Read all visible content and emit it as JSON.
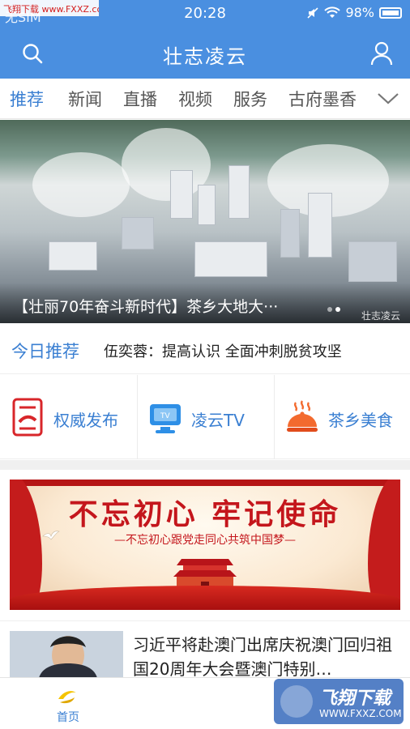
{
  "watermark_top": "飞翔下载 www.FXXZ.com",
  "status_bar": {
    "carrier": "无SIM",
    "time": "20:28",
    "battery": "98%"
  },
  "navbar": {
    "title": "壮志凌云",
    "search_icon": "search-icon",
    "user_icon": "user-icon"
  },
  "tabs": [
    {
      "label": "推荐",
      "active": true
    },
    {
      "label": "新闻",
      "active": false
    },
    {
      "label": "直播",
      "active": false
    },
    {
      "label": "视频",
      "active": false
    },
    {
      "label": "服务",
      "active": false
    },
    {
      "label": "古府墨香",
      "active": false
    }
  ],
  "banner": {
    "caption": "【壮丽70年奋斗新时代】茶乡大地大···",
    "source": "壮志凌云",
    "slides": 2,
    "active_slide": 2
  },
  "today": {
    "label": "今日推荐",
    "headline": "伍奕蓉：提高认识 全面冲刺脱贫攻坚"
  },
  "quick_links": [
    {
      "label": "权威发布",
      "icon": "document-icon"
    },
    {
      "label": "凌云TV",
      "icon": "tv-icon"
    },
    {
      "label": "茶乡美食",
      "icon": "food-dish-icon"
    }
  ],
  "promo": {
    "title": "不忘初心  牢记使命",
    "subtitle": "—不忘初心跟党走同心共筑中国梦—"
  },
  "news": [
    {
      "title": "习近平将赴澳门出席庆祝澳门回归祖国20周年大会暨澳门特别…"
    }
  ],
  "bottom_tabs": [
    {
      "label": "首页",
      "active": true
    }
  ],
  "watermark_badge": {
    "main": "飞翔下载",
    "url": "WWW.FXXZ.COM"
  },
  "colors": {
    "brand": "#4a8fe0",
    "accent_text": "#3a7fd2",
    "promo_red": "#c4161c"
  }
}
